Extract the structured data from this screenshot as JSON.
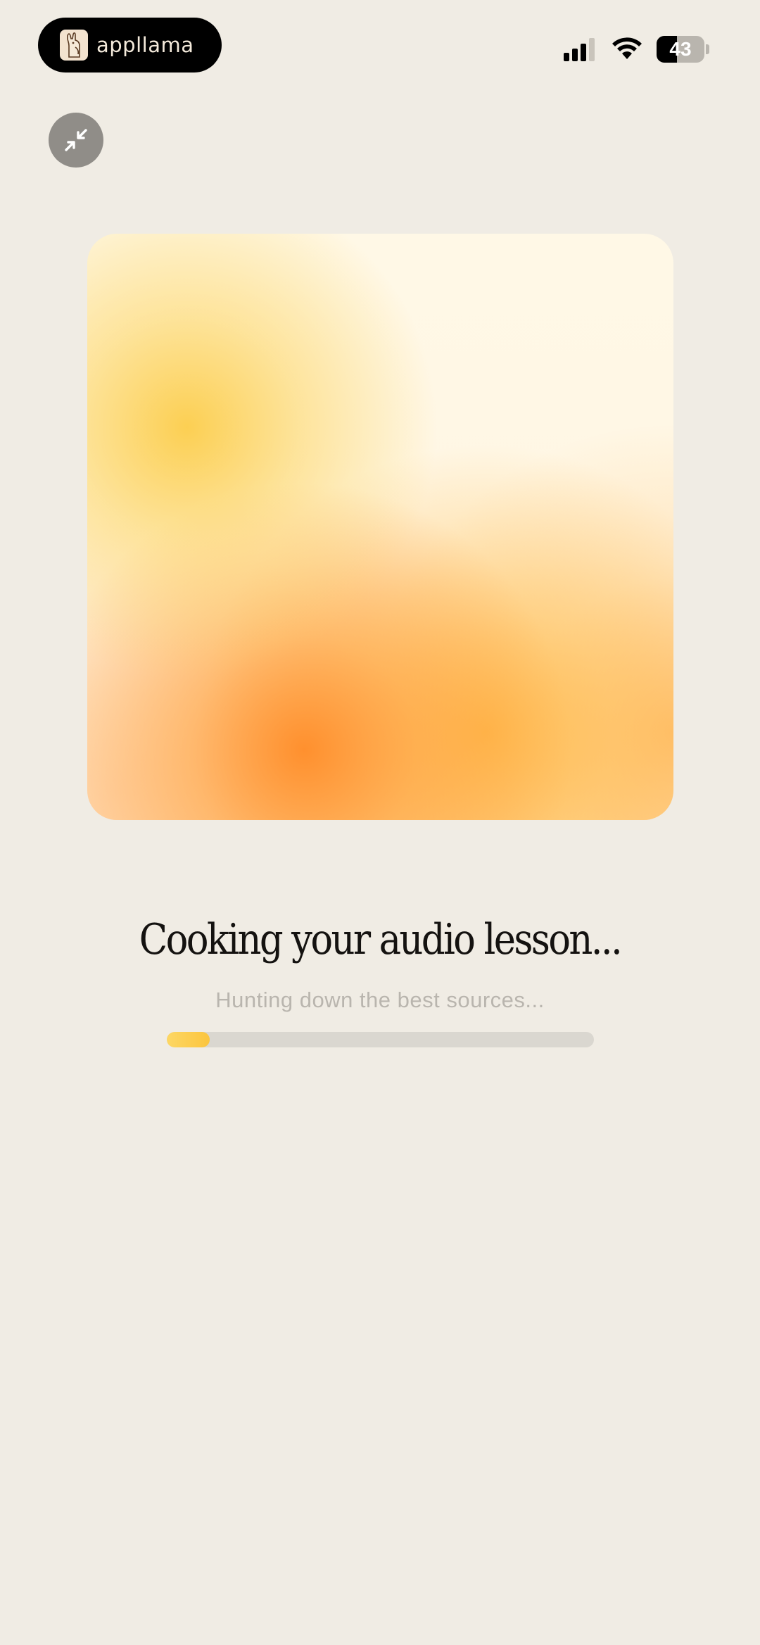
{
  "status_bar": {
    "app_pill_label": "appllama",
    "battery_level": "43"
  },
  "player": {
    "minimize_icon": "minimize-arrows-icon",
    "artwork_colors": [
      "#fcd14e",
      "#ff8f33",
      "#ffbd45",
      "#fff8e6"
    ]
  },
  "loading": {
    "title": "Cooking your audio lesson...",
    "subtitle": "Hunting down the best sources...",
    "progress_fraction": 0.1,
    "progress_color": "#fdd764"
  },
  "colors": {
    "background": "#f0ece4",
    "track": "#dad7d0"
  }
}
